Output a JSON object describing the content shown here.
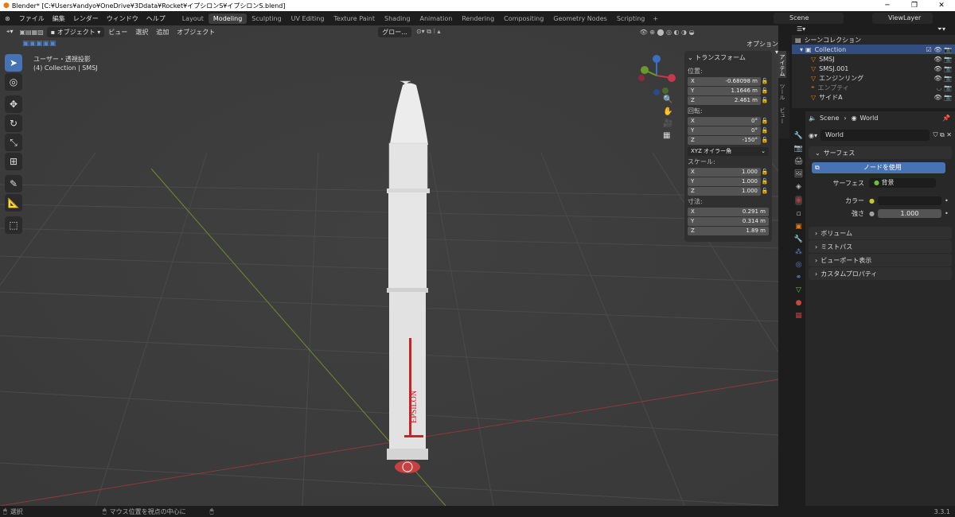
{
  "window_title": "Blender* [C:¥Users¥andyo¥OneDrive¥3Ddata¥Rocket¥イプシロンS¥イプシロンS.blend]",
  "menus": [
    "ファイル",
    "編集",
    "レンダー",
    "ウィンドウ",
    "ヘルプ"
  ],
  "workspaces": [
    "Layout",
    "Modeling",
    "Sculpting",
    "UV Editing",
    "Texture Paint",
    "Shading",
    "Animation",
    "Rendering",
    "Compositing",
    "Geometry Nodes",
    "Scripting"
  ],
  "active_workspace": "Modeling",
  "scene_name": "Scene",
  "view_layer": "ViewLayer",
  "viewport": {
    "mode": "オブジェクト",
    "header_menus": [
      "ビュー",
      "選択",
      "追加",
      "オブジェクト"
    ],
    "orientation": "グロー...",
    "options_label": "オプション",
    "view_title": "ユーザー・透視投影",
    "collection_info": "(4) Collection | SMSJ",
    "side_tabs": [
      "アイテム",
      "ツール",
      "ビュー"
    ]
  },
  "transform_panel": {
    "title": "トランスフォーム",
    "location_label": "位置:",
    "location": [
      {
        "axis": "X",
        "value": "-0.68098 m"
      },
      {
        "axis": "Y",
        "value": "1.1646 m"
      },
      {
        "axis": "Z",
        "value": "2.461 m"
      }
    ],
    "rotation_label": "回転:",
    "rotation": [
      {
        "axis": "X",
        "value": "0°"
      },
      {
        "axis": "Y",
        "value": "0°"
      },
      {
        "axis": "Z",
        "value": "-150°"
      }
    ],
    "rotation_mode": "XYZ オイラー角",
    "scale_label": "スケール:",
    "scale": [
      {
        "axis": "X",
        "value": "1.000"
      },
      {
        "axis": "Y",
        "value": "1.000"
      },
      {
        "axis": "Z",
        "value": "1.000"
      }
    ],
    "dimensions_label": "寸法:",
    "dimensions": [
      {
        "axis": "X",
        "value": "0.291 m"
      },
      {
        "axis": "Y",
        "value": "0.314 m"
      },
      {
        "axis": "Z",
        "value": "1.89 m"
      }
    ]
  },
  "rocket_label": "EPSILON",
  "outliner": {
    "root": "シーンコレクション",
    "collection": "Collection",
    "items": [
      "SMSJ",
      "SMSJ.001",
      "エンジンリング",
      "エンプティ",
      "サイドA"
    ]
  },
  "properties": {
    "breadcrumb_scene": "Scene",
    "breadcrumb_world": "World",
    "world_name": "World",
    "surface_section": "サーフェス",
    "use_nodes_button": "ノードを使用",
    "surface_label": "サーフェス",
    "surface_value": "背景",
    "color_label": "カラー",
    "strength_label": "強さ",
    "strength_value": "1.000",
    "collapsed_sections": [
      "ボリューム",
      "ミストパス",
      "ビューポート表示",
      "カスタムプロパティ"
    ]
  },
  "statusbar": {
    "select": "選択",
    "rotate_view": "マウス位置を視点の中心に",
    "version": "3.3.1"
  },
  "colors": {
    "accent": "#4772b3",
    "viewport_bg": "#3d3d3d",
    "panel_bg": "#303030"
  }
}
